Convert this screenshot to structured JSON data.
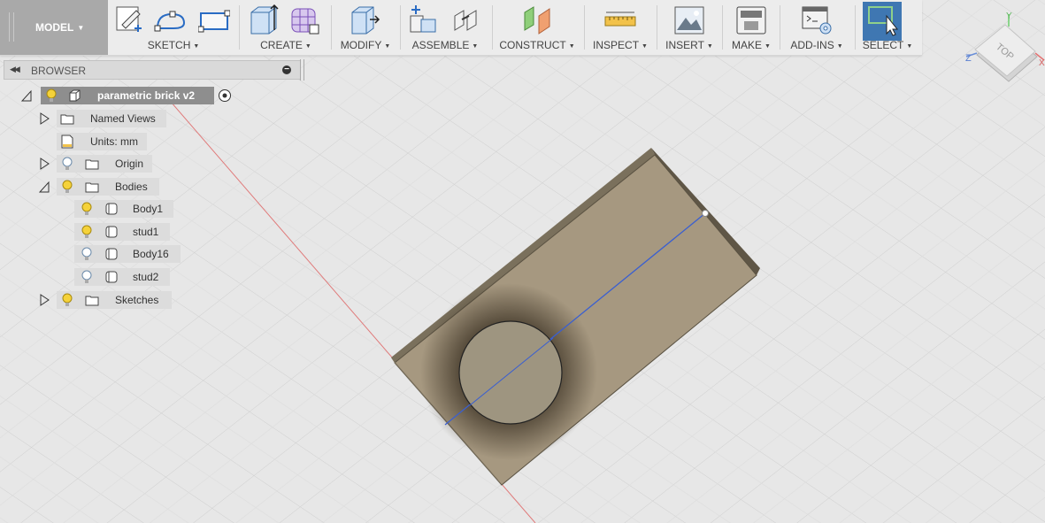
{
  "model_menu": {
    "label": "MODEL"
  },
  "toolbar": {
    "groups": [
      {
        "id": "sketch",
        "label": "SKETCH"
      },
      {
        "id": "create",
        "label": "CREATE"
      },
      {
        "id": "modify",
        "label": "MODIFY"
      },
      {
        "id": "assemble",
        "label": "ASSEMBLE"
      },
      {
        "id": "construct",
        "label": "CONSTRUCT"
      },
      {
        "id": "inspect",
        "label": "INSPECT"
      },
      {
        "id": "insert",
        "label": "INSERT"
      },
      {
        "id": "make",
        "label": "MAKE"
      },
      {
        "id": "addins",
        "label": "ADD-INS"
      },
      {
        "id": "select",
        "label": "SELECT"
      }
    ],
    "icons": [
      "sketch-pencil-icon",
      "sketch-arc-icon",
      "sketch-rectangle-icon",
      "extrude-icon",
      "form-icon",
      "press-pull-icon",
      "new-component-icon",
      "joint-icon",
      "offset-plane-icon",
      "measure-icon",
      "insert-canvas-icon",
      "make-3d-print-icon",
      "scripts-addins-icon",
      "select-icon"
    ]
  },
  "browser": {
    "title": "BROWSER",
    "root": {
      "label": "parametric brick v2"
    },
    "items": [
      {
        "label": "Named Views",
        "icon": "folder-icon"
      },
      {
        "label": "Units: mm",
        "icon": "document-icon"
      },
      {
        "label": "Origin",
        "icon": "folder-icon"
      },
      {
        "label": "Bodies",
        "icon": "folder-icon"
      },
      {
        "label": "Body1",
        "icon": "body-icon"
      },
      {
        "label": "stud1",
        "icon": "body-icon"
      },
      {
        "label": "Body16",
        "icon": "body-icon"
      },
      {
        "label": "stud2",
        "icon": "body-icon"
      },
      {
        "label": "Sketches",
        "icon": "folder-icon"
      }
    ]
  },
  "viewcube": {
    "face": "TOP",
    "axis_x": "X",
    "axis_y": "Y",
    "axis_z": "Z"
  },
  "colors": {
    "brick": "#a69880",
    "brick_edge": "#6d6350",
    "stud": "#9e9580",
    "sketch_line": "#3a5fd0",
    "axis_red": "#e07a7a",
    "select_active": "#3f77b2"
  }
}
